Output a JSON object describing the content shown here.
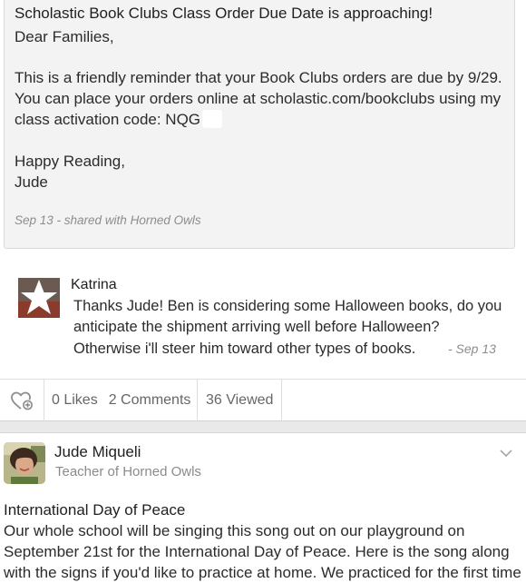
{
  "announcement": {
    "title": "Scholastic Book Clubs Class Order Due Date is approaching!",
    "greeting": "Dear Families,",
    "body_line1": "This is a friendly reminder that your Book Clubs orders are due by 9/29.",
    "body_line2": "You can place your orders online at scholastic.com/bookclubs using my",
    "body_line3_prefix": "class activation code: NQG",
    "closing": "Happy Reading,",
    "signature": "Jude",
    "meta": "Sep 13 - shared with Horned Owls"
  },
  "comment": {
    "author": "Katrina",
    "line1": "Thanks Jude! Ben is considering some Halloween books, do you",
    "line2": "anticipate the shipment arriving well before Halloween?",
    "line3": "Otherwise i'll steer him toward other types of books.",
    "date": "- Sep 13"
  },
  "stats": {
    "likes": "0 Likes",
    "comments": "2 Comments",
    "viewed": "36 Viewed"
  },
  "next_post": {
    "author_name": "Jude Miqueli",
    "author_role": "Teacher of Horned Owls",
    "title": "International Day of Peace",
    "line1": "Our whole school will be singing this song out on our playground on",
    "line2": "September 21st for the International Day of Peace.  Here is the song along",
    "line3": "with the signs if you'd like to practice at home. We practiced for the first time"
  },
  "icons": {
    "like": "heart-plus-icon",
    "menu": "chevron-down-icon",
    "comment_avatar": "star-avatar",
    "author_avatar": "photo-avatar"
  },
  "colors": {
    "card_bg": "#f3f3f3",
    "muted_text": "#8d8d8d",
    "divider": "#e9e9e9"
  }
}
